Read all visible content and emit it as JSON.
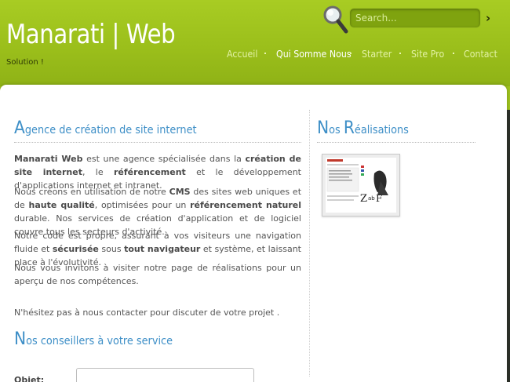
{
  "header": {
    "logo": "Manarati | Web",
    "slogan": "Solution !",
    "search_placeholder": "Search...",
    "search_go": "›"
  },
  "nav": {
    "items": [
      "Accueil",
      "Qui Somme Nous",
      "Starter",
      "Site Pro",
      "Contact"
    ],
    "active": "Qui Somme Nous"
  },
  "main": {
    "title_first": "A",
    "title_rest": "gence de création de site internet",
    "p1": {
      "a": "Manarati Web",
      "b": " est une agence spécialisée dans la ",
      "c": "création de site internet",
      "d": ", le ",
      "e": "référencement",
      "f": " et le développement d'applications internet et intranet."
    },
    "p2": {
      "a": "Nous créons en utilisation de notre ",
      "b": "CMS",
      "c": " des sites web uniques et de ",
      "d": "haute qualité",
      "e": ", optimisées pour un ",
      "f": "référencement naturel",
      "g": " durable. Nos services de création d'application et de logiciel couvre tous les secteurs d'activité."
    },
    "p3": {
      "a": "Notre code est propre, assurant à vos visiteurs une navigation fluide et ",
      "b": "sécurisée",
      "c": " sous ",
      "d": "tout navigateur",
      "e": " et système, et laissant place à l'évolutivité."
    },
    "p4": "Nous vous invitons à visiter notre page de réalisations pour un aperçu de nos compétences.",
    "p5": "N'hésitez pas à nous contacter pour discuter de votre projet .",
    "advisors_first": "N",
    "advisors_rest": "os conseillers à votre service",
    "form_label": "Objet:"
  },
  "sidebar": {
    "title_first": "N",
    "title_mid": "os ",
    "title_second": "R",
    "title_rest": "éalisations"
  },
  "colors": {
    "header_green": "#9ec21e",
    "title_blue": "#3e8fc7",
    "body_text": "#555555"
  }
}
